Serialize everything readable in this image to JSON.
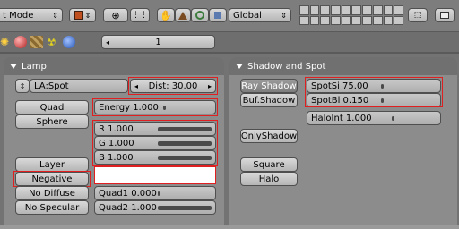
{
  "header": {
    "mode_label": "t Mode",
    "orientation_label": "Global"
  },
  "toolbar2": {
    "frame_value": "1"
  },
  "lamp_panel": {
    "title": "Lamp",
    "lamp_name": "LA:Spot",
    "dist_label": "Dist: 30.00",
    "quad_label": "Quad",
    "sphere_label": "Sphere",
    "energy_label": "Energy 1.000",
    "r_label": "R 1.000",
    "g_label": "G 1.000",
    "b_label": "B 1.000",
    "layer_label": "Layer",
    "negative_label": "Negative",
    "no_diffuse_label": "No Diffuse",
    "no_specular_label": "No Specular",
    "quad1_label": "Quad1 0.000",
    "quad2_label": "Quad2 1.000"
  },
  "shadow_panel": {
    "title": "Shadow and Spot",
    "ray_shadow_label": "Ray Shadow",
    "buf_shadow_label": "Buf.Shadow",
    "only_shadow_label": "OnlyShadow",
    "square_label": "Square",
    "halo_label": "Halo",
    "spotsi_label": "SpotSi 75.00",
    "spotbl_label": "SpotBl 0.150",
    "haloint_label": "HaloInt 1.000"
  },
  "colors": {
    "highlight": "#e02020",
    "panel_bg": "#8c8c8c",
    "header_bg": "#707070"
  }
}
